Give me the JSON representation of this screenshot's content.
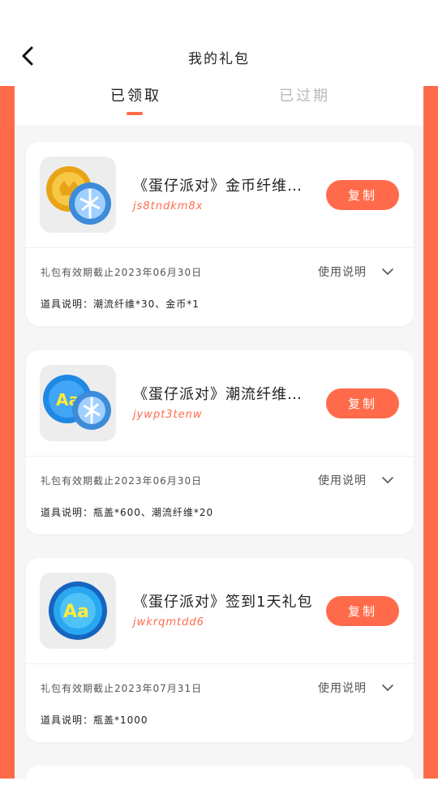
{
  "header": {
    "title": "我的礼包"
  },
  "tabs": [
    {
      "label": "已领取",
      "active": true
    },
    {
      "label": "已过期",
      "active": false
    }
  ],
  "colors": {
    "accent": "#ff6b4a"
  },
  "cards": [
    {
      "name": "《蛋仔派对》金币纤维礼包",
      "code": "js8tndkm8x",
      "copy_label": "复制",
      "expiry": "礼包有效期截止2023年06月30日",
      "usage_label": "使用说明",
      "items": "道具说明：潮流纤维*30、金币*1",
      "icon": "coin-and-fiber-icon"
    },
    {
      "name": "《蛋仔派对》潮流纤维礼包",
      "code": "jywpt3tenw",
      "copy_label": "复制",
      "expiry": "礼包有效期截止2023年06月30日",
      "usage_label": "使用说明",
      "items": "道具说明：瓶盖*600、潮流纤维*20",
      "icon": "bottlecap-and-fiber-icon"
    },
    {
      "name": "《蛋仔派对》签到1天礼包",
      "code": "jwkrqmtdd6",
      "copy_label": "复制",
      "expiry": "礼包有效期截止2023年07月31日",
      "usage_label": "使用说明",
      "items": "道具说明：瓶盖*1000",
      "icon": "bottlecap-icon"
    }
  ]
}
